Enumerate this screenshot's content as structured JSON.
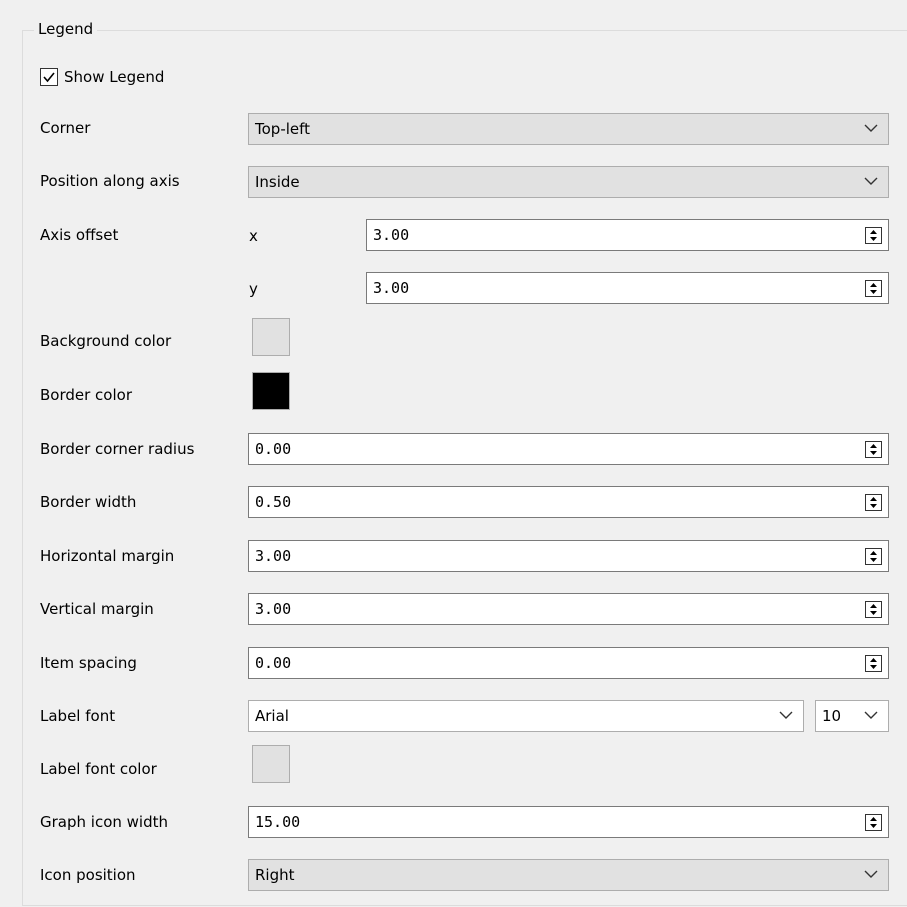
{
  "group": {
    "title": "Legend"
  },
  "show_legend": {
    "label": "Show Legend",
    "checked": true
  },
  "rows": {
    "corner": {
      "label": "Corner",
      "value": "Top-left"
    },
    "position_along_axis": {
      "label": "Position along axis",
      "value": "Inside"
    },
    "axis_offset": {
      "label": "Axis offset",
      "x_label": "x",
      "x_value": "3.00",
      "y_label": "y",
      "y_value": "3.00"
    },
    "background_color": {
      "label": "Background color",
      "color": "#e1e1e1"
    },
    "border_color": {
      "label": "Border color",
      "color": "#000000"
    },
    "border_corner_radius": {
      "label": "Border corner radius",
      "value": "0.00"
    },
    "border_width": {
      "label": "Border width",
      "value": "0.50"
    },
    "horizontal_margin": {
      "label": "Horizontal margin",
      "value": "3.00"
    },
    "vertical_margin": {
      "label": "Vertical margin",
      "value": "3.00"
    },
    "item_spacing": {
      "label": "Item spacing",
      "value": "0.00"
    },
    "label_font": {
      "label": "Label font",
      "value": "Arial",
      "size": "10"
    },
    "label_font_color": {
      "label": "Label font color",
      "color": "#e1e1e1"
    },
    "graph_icon_width": {
      "label": "Graph icon width",
      "value": "15.00"
    },
    "icon_position": {
      "label": "Icon position",
      "value": "Right"
    }
  }
}
